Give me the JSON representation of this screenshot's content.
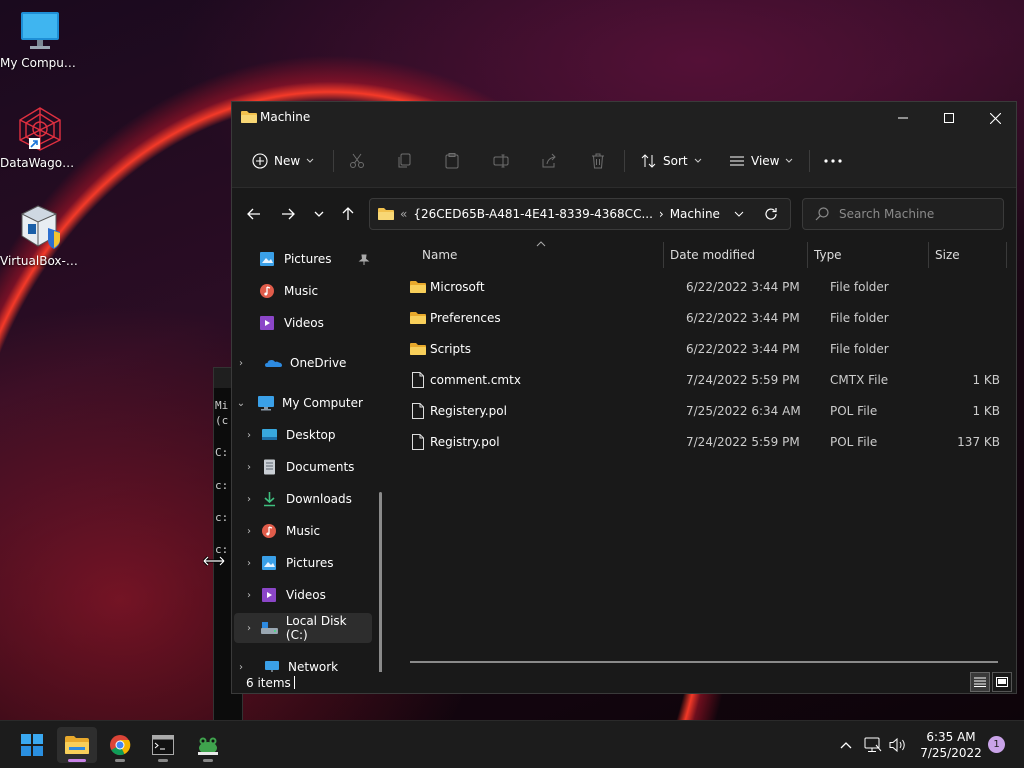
{
  "desktop": {
    "icons": [
      {
        "label": "My Computer",
        "icon": "monitor-icon"
      },
      {
        "label": "DataWagon...",
        "icon": "datawagon-app-icon"
      },
      {
        "label": "VirtualBox-6...",
        "icon": "virtualbox-installer-icon"
      }
    ]
  },
  "console": {
    "lines": [
      "Mi",
      "(c",
      "C:",
      "c:",
      "c:",
      "c:"
    ]
  },
  "explorer": {
    "title": "Machine",
    "toolbar": {
      "new_label": "New",
      "sort_label": "Sort",
      "view_label": "View"
    },
    "address": {
      "prefix": "«",
      "segment1": "{26CED65B-A481-4E41-8339-4368CC...",
      "separator": "›",
      "segment2": "Machine"
    },
    "search_placeholder": "Search Machine",
    "sidebar": {
      "items": [
        {
          "label": "Pictures",
          "icon": "pictures-icon",
          "pinned": true
        },
        {
          "label": "Music",
          "icon": "music-icon"
        },
        {
          "label": "Videos",
          "icon": "videos-icon"
        },
        {
          "label": "OneDrive",
          "icon": "onedrive-icon"
        },
        {
          "label": "My Computer",
          "icon": "computer-icon"
        },
        {
          "label": "Desktop",
          "icon": "desktop-folder-icon"
        },
        {
          "label": "Documents",
          "icon": "documents-icon"
        },
        {
          "label": "Downloads",
          "icon": "downloads-icon"
        },
        {
          "label": "Music",
          "icon": "music-icon"
        },
        {
          "label": "Pictures",
          "icon": "pictures-icon"
        },
        {
          "label": "Videos",
          "icon": "videos-icon"
        },
        {
          "label": "Local Disk (C:)",
          "icon": "drive-icon"
        },
        {
          "label": "Network",
          "icon": "network-icon"
        }
      ]
    },
    "columns": {
      "name": "Name",
      "date": "Date modified",
      "type": "Type",
      "size": "Size"
    },
    "files": [
      {
        "name": "Microsoft",
        "date": "6/22/2022 3:44 PM",
        "type": "File folder",
        "size": "",
        "kind": "folder"
      },
      {
        "name": "Preferences",
        "date": "6/22/2022 3:44 PM",
        "type": "File folder",
        "size": "",
        "kind": "folder"
      },
      {
        "name": "Scripts",
        "date": "6/22/2022 3:44 PM",
        "type": "File folder",
        "size": "",
        "kind": "folder"
      },
      {
        "name": "comment.cmtx",
        "date": "7/24/2022 5:59 PM",
        "type": "CMTX File",
        "size": "1 KB",
        "kind": "file"
      },
      {
        "name": "Registery.pol",
        "date": "7/25/2022 6:34 AM",
        "type": "POL File",
        "size": "1 KB",
        "kind": "file"
      },
      {
        "name": "Registry.pol",
        "date": "7/24/2022 5:59 PM",
        "type": "POL File",
        "size": "137 KB",
        "kind": "file"
      }
    ],
    "status": {
      "count": "6 items"
    }
  },
  "taskbar": {
    "time": "6:35 AM",
    "date": "7/25/2022",
    "notification_count": "1"
  },
  "colors": {
    "folder_yellow": "#f2c14e",
    "accent": "#c882e6"
  }
}
